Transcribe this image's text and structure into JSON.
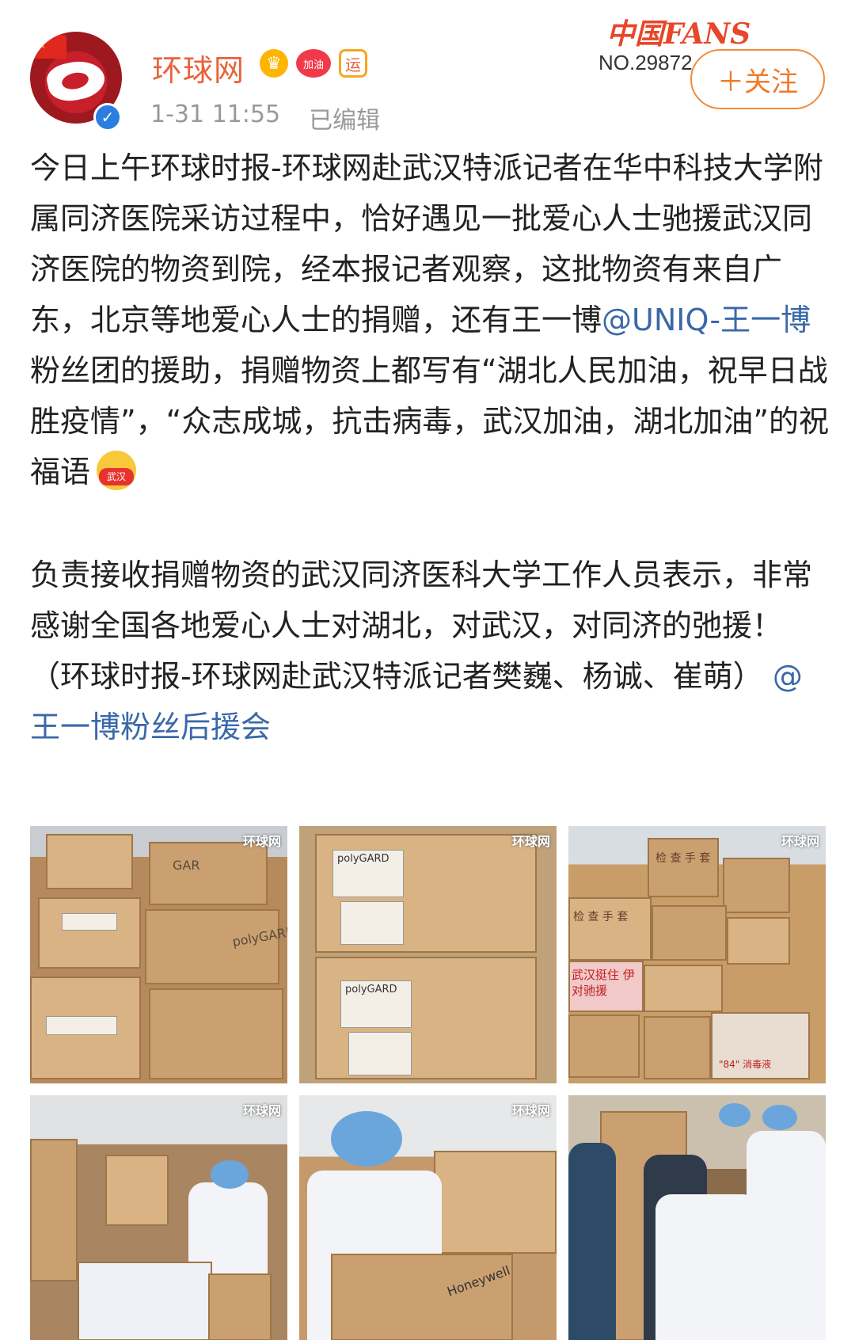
{
  "account": {
    "name": "环球网",
    "badges": {
      "crown": "♛",
      "heart": "加油",
      "yun": "运"
    },
    "time": "1-31 11:55",
    "edited": "已编辑",
    "verified_glyph": "✓"
  },
  "fans_badge": {
    "title": "中国FANS",
    "number": "NO.29872"
  },
  "follow_label": "＋关注",
  "post": {
    "p1_before": "今日上午环球时报-环球网赴武汉特派记者在华中科技大学附属同济医院采访过程中，恰好遇见一批爱心人士驰援武汉同济医院的物资到院，经本报记者观察，这批物资有来自广东，北京等地爱心人士的捐赠，还有王一博",
    "p1_mention": "@UNIQ-王一博",
    "p1_after": " 粉丝团的援助，捐赠物资上都写有“湖北人民加油，祝早日战胜疫情”，“众志成城，抗击病毒，武汉加油，湖北加油”的祝福语",
    "p2_before": "负责接收捐赠物资的武汉同济医科大学工作人员表示，非常感谢全国各地爱心人士对湖北，对武汉，对同济的弛援！（环球时报-环球网赴武汉特派记者樊巍、杨诚、崔萌）",
    "p2_mention": "@王一博粉丝后援会"
  },
  "photos": {
    "watermark": "环球网",
    "box_brand": "polyGARD",
    "box_brand_top": "GAR",
    "label_glove": "检 查 手 套",
    "label_slogan": "武汉挺住 伊对驰援",
    "label_honeywell": "Honeywell",
    "label_84": "\"84\" 消毒液"
  }
}
